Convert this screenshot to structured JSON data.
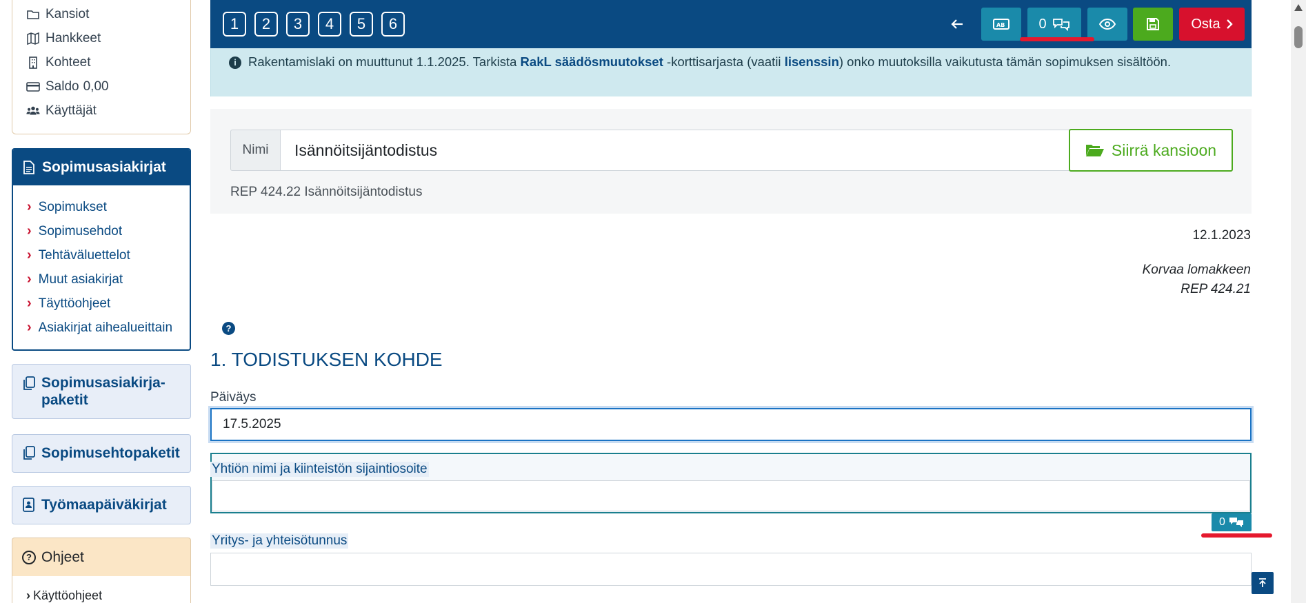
{
  "sidebar": {
    "top_links": [
      {
        "label": "Kansiot",
        "icon": "folder-icon"
      },
      {
        "label": "Hankkeet",
        "icon": "map-icon"
      },
      {
        "label": "Kohteet",
        "icon": "building-icon"
      },
      {
        "label": "Saldo",
        "value": "0,00",
        "icon": "wallet-icon"
      },
      {
        "label": "Käyttäjät",
        "icon": "users-icon"
      }
    ],
    "docs": {
      "header": "Sopimusasiakirjat",
      "items": [
        "Sopimukset",
        "Sopimusehdot",
        "Tehtäväluettelot",
        "Muut asiakirjat",
        "Täyttöohjeet",
        "Asiakirjat aihealueittain"
      ]
    },
    "packages": [
      "Sopimusasiakirja-\npaketit",
      "Sopimusehtopaketit",
      "Työmaapäiväkirjat"
    ],
    "help": {
      "header": "Ohjeet",
      "item": "Käyttöohjeet"
    }
  },
  "toolbar": {
    "steps": [
      "1",
      "2",
      "3",
      "4",
      "5",
      "6"
    ],
    "comments_count": "0",
    "buy_label": "Osta"
  },
  "notice": {
    "text_1": "Rakentamislaki on muuttunut 1.1.2025. Tarkista ",
    "link_1": "RakL säädösmuutokset",
    "text_2": " -korttisarjasta (vaatii ",
    "link_2": "lisenssin",
    "text_3": ") onko muutoksilla vaikutusta tämän sopimuksen sisältöön."
  },
  "document": {
    "name_label": "Nimi",
    "name_value": "Isännöitsijäntodistus",
    "move_label": "Siirrä kansioon",
    "form_code": "REP 424.22 Isännöitsijäntodistus",
    "date": "12.1.2023",
    "replaces_line1": "Korvaa lomakkeen",
    "replaces_line2": "REP 424.21",
    "section_title": "1. TODISTUKSEN KOHDE",
    "fields": [
      {
        "label": "Päiväys",
        "value": "17.5.2025"
      },
      {
        "label": "Yhtiön nimi ja kiinteistön sijaintiosoite",
        "value": ""
      },
      {
        "label": "Yritys- ja yhteisötunnus",
        "value": ""
      }
    ],
    "field_comment_count": "0"
  },
  "colors": {
    "primary": "#0a4a82",
    "teal": "#1a8aaa",
    "green": "#4caa1e",
    "red": "#d7112d",
    "highlight_underline": "#e5192e"
  }
}
